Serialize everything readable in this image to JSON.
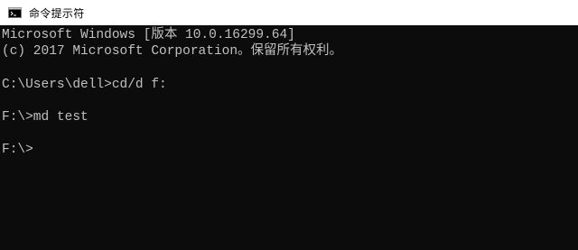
{
  "window": {
    "title": "命令提示符",
    "icon": "cmd-icon"
  },
  "console": {
    "lines": [
      "Microsoft Windows [版本 10.0.16299.64]",
      "(c) 2017 Microsoft Corporation。保留所有权利。",
      "",
      "C:\\Users\\dell>cd/d f:",
      "",
      "F:\\>md test",
      "",
      "F:\\>"
    ]
  },
  "colors": {
    "background": "#0c0c0c",
    "text": "#c0c0c0",
    "titlebar": "#ffffff"
  }
}
